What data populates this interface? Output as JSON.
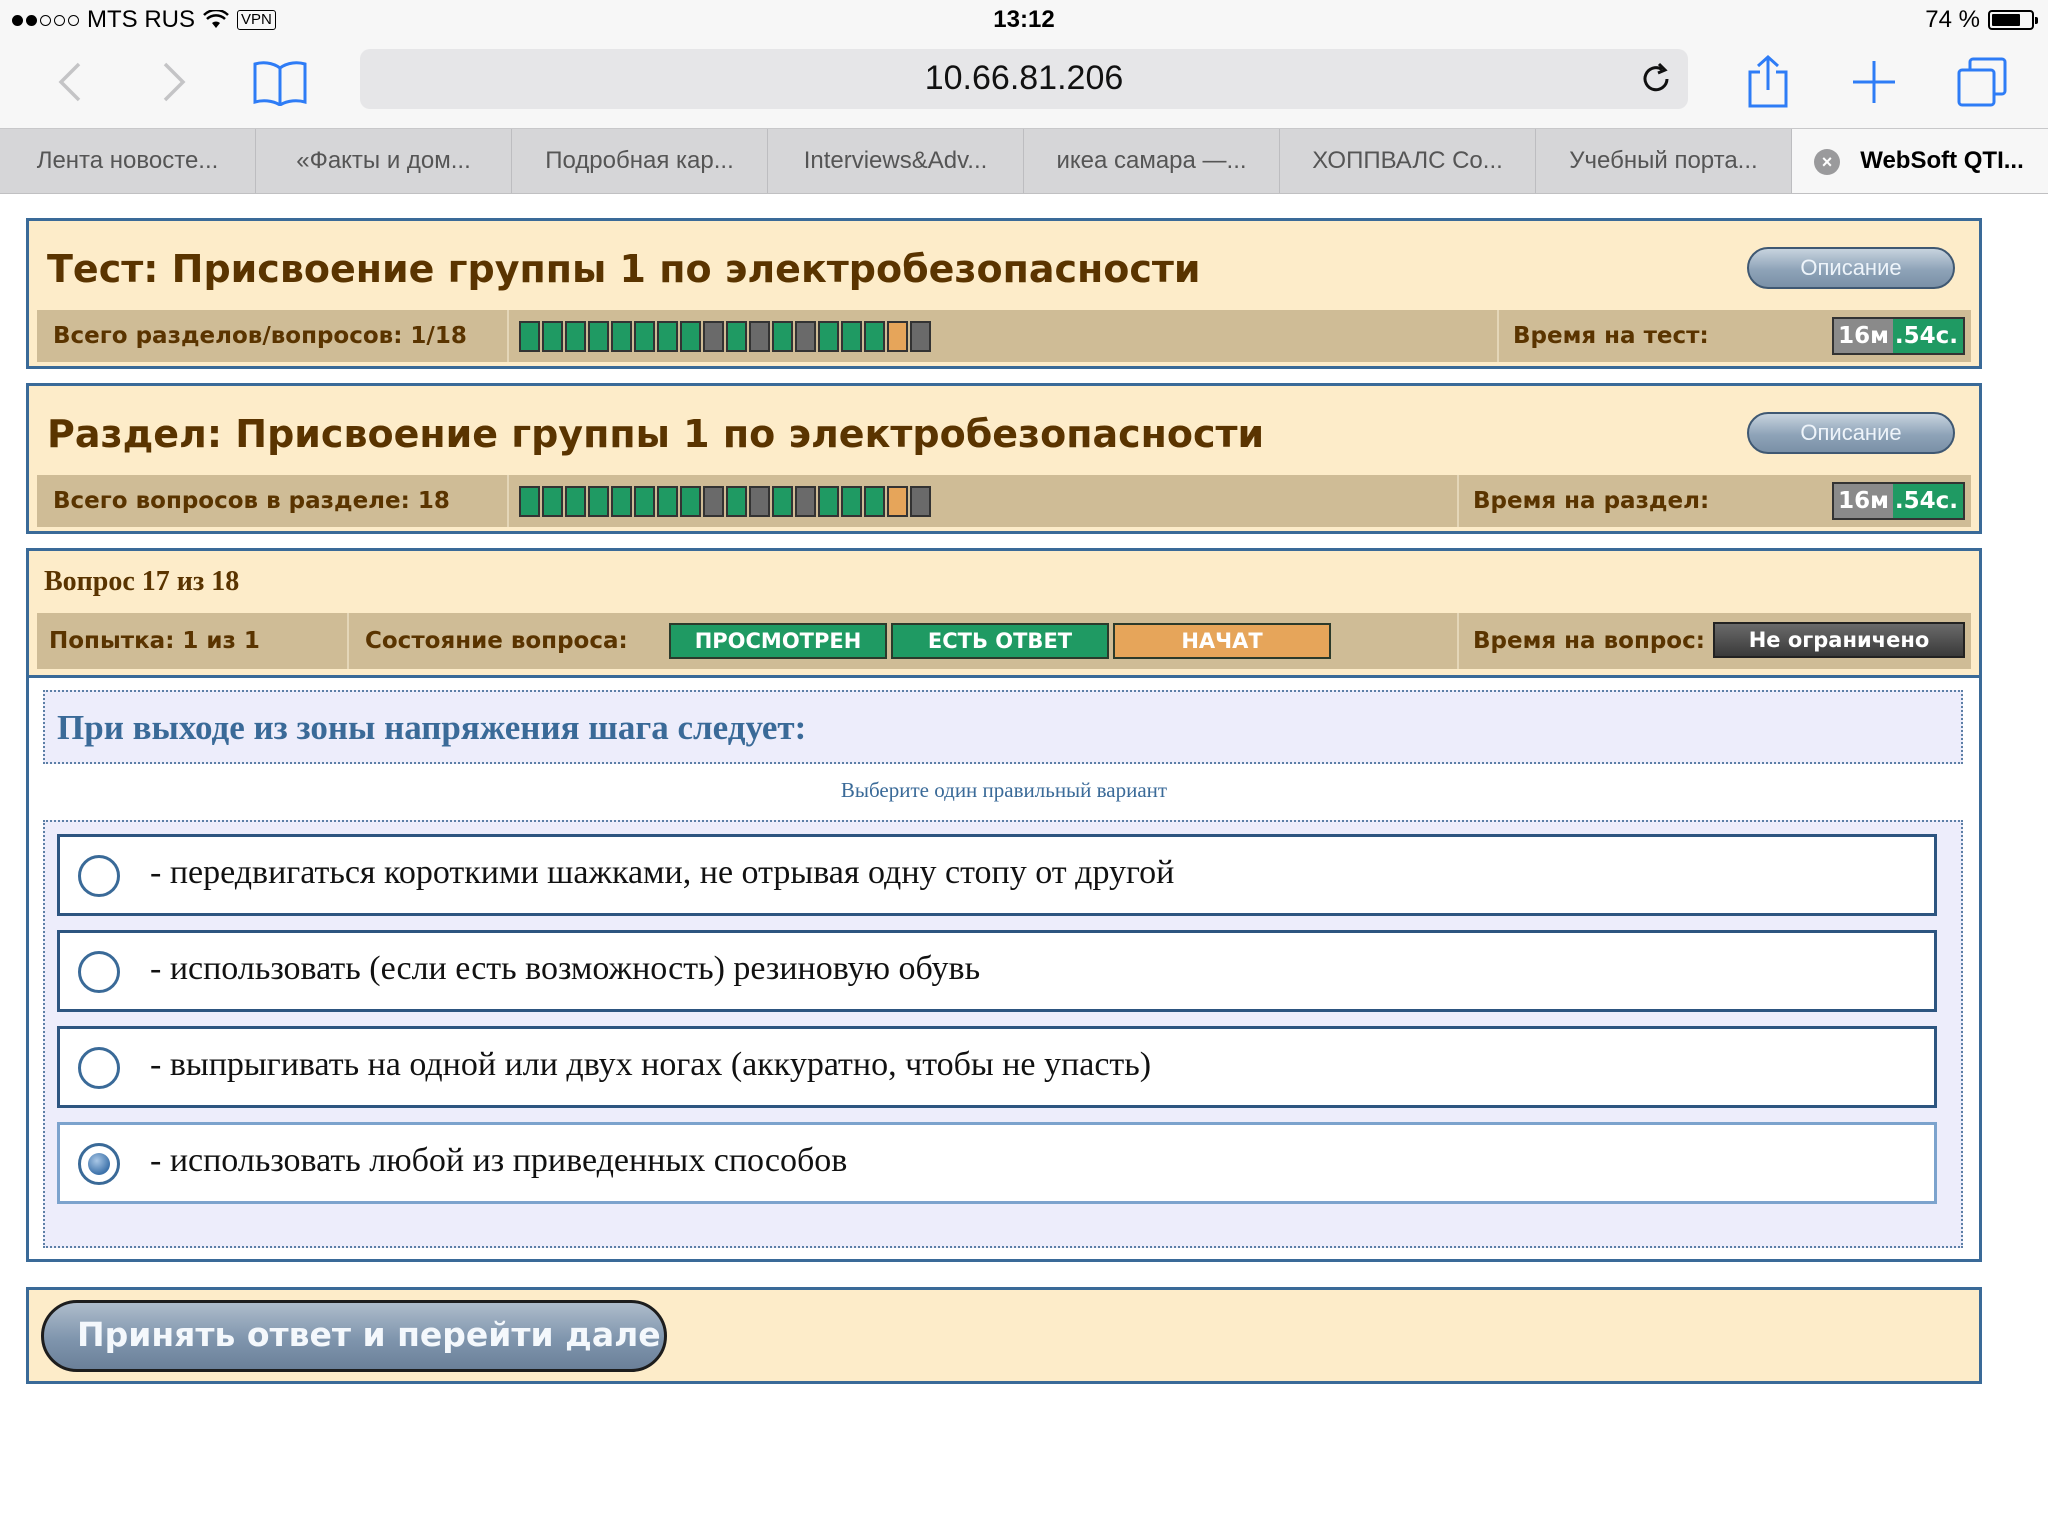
{
  "status_bar": {
    "carrier": "MTS RUS",
    "vpn": "VPN",
    "time": "13:12",
    "battery": "74 %",
    "battery_fraction": 0.74
  },
  "browser": {
    "url": "10.66.81.206",
    "tabs": [
      {
        "label": "Лента новосте..."
      },
      {
        "label": "«Факты и дом..."
      },
      {
        "label": "Подробная кар..."
      },
      {
        "label": "Interviews&Adv..."
      },
      {
        "label": "икеа самара —..."
      },
      {
        "label": "ХОППВАЛС Co..."
      },
      {
        "label": "Учебный порта..."
      },
      {
        "label": "WebSoft QTI..."
      }
    ]
  },
  "test_panel": {
    "title": "Тест: Присвоение группы 1 по электробезопасности",
    "desc_label": "Описание",
    "count_label": "Всего разделов/вопросов: 1/18",
    "time_label": "Время на тест:",
    "timer_min": "16м",
    "timer_sec": ".54с.",
    "progress": [
      "answered",
      "answered",
      "answered",
      "answered",
      "answered",
      "answered",
      "answered",
      "answered",
      "viewed",
      "answered",
      "viewed",
      "answered",
      "viewed",
      "answered",
      "answered",
      "answered",
      "current",
      "viewed"
    ]
  },
  "section_panel": {
    "title": "Раздел: Присвоение группы 1 по электробезопасности",
    "desc_label": "Описание",
    "count_label": "Всего вопросов в разделе: 18",
    "time_label": "Время на раздел:",
    "timer_min": "16м",
    "timer_sec": ".54с.",
    "progress": [
      "answered",
      "answered",
      "answered",
      "answered",
      "answered",
      "answered",
      "answered",
      "answered",
      "viewed",
      "answered",
      "viewed",
      "answered",
      "viewed",
      "answered",
      "answered",
      "answered",
      "current",
      "viewed"
    ]
  },
  "question_panel": {
    "heading": "Вопрос 17 из 18",
    "attempt_label": "Попытка: 1 из 1",
    "state_label": "Состояние вопроса:",
    "states": [
      "ПРОСМОТРЕН",
      "ЕСТЬ ОТВЕТ",
      "НАЧАТ"
    ],
    "time_label": "Время на вопрос:",
    "time_value": "Не ограничено",
    "question": "При выходе из зоны напряжения шага следует:",
    "hint": "Выберите один правильный вариант",
    "answers": [
      {
        "text": "- передвигаться короткими шажками, не отрывая одну стопу от другой",
        "selected": false
      },
      {
        "text": "- использовать (если есть возможность) резиновую обувь",
        "selected": false
      },
      {
        "text": "- выпрыгивать на одной или двух ногах (аккуратно, чтобы не упасть)",
        "selected": false
      },
      {
        "text": "- использовать любой из приведенных способов",
        "selected": true
      }
    ]
  },
  "submit": {
    "label": "Принять ответ и перейти дале"
  },
  "colors": {
    "panel_bg": "#fdecc9",
    "border": "#3a6a98",
    "answered": "#1f9a63",
    "viewed": "#6a6a6a",
    "current": "#e6a55a"
  }
}
